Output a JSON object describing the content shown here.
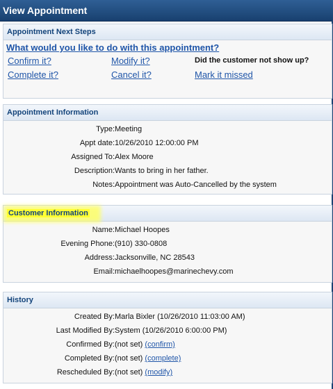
{
  "window": {
    "title": "View Appointment"
  },
  "next_steps": {
    "title": "Appointment Next Steps",
    "question": "What would you like to do with this appointment?",
    "confirm": "Confirm it?",
    "modify": "Modify it?",
    "complete": "Complete it?",
    "cancel": "Cancel it?",
    "no_show_question": "Did the customer not show up?",
    "mark_missed": "Mark it missed"
  },
  "appointment": {
    "title": "Appointment Information",
    "rows": [
      {
        "label": "Type:",
        "value": "Meeting"
      },
      {
        "label": "Appt date:",
        "value": "10/26/2010 12:00:00 PM"
      },
      {
        "label": "Assigned To:",
        "value": "Alex Moore"
      },
      {
        "label": "Description:",
        "value": "Wants to bring in her father."
      },
      {
        "label": "Notes:",
        "value": "Appointment was Auto-Cancelled by the system"
      }
    ]
  },
  "customer": {
    "title": "Customer Information",
    "rows": [
      {
        "label": "Name:",
        "value": "Michael Hoopes"
      },
      {
        "label": "Evening Phone:",
        "value": "(910) 330-0808"
      },
      {
        "label": "Address:",
        "value": "Jacksonville, NC 28543"
      },
      {
        "label": "Email:",
        "value": "michaelhoopes@marinechevy.com"
      }
    ]
  },
  "history": {
    "title": "History",
    "rows": [
      {
        "label": "Created By:",
        "value": "Marla Bixler (10/26/2010 11:03:00 AM)"
      },
      {
        "label": "Last Modified By:",
        "value": "System (10/26/2010 6:00:00 PM)"
      },
      {
        "label": "Confirmed By:",
        "value": "(not set)",
        "link": "(confirm)"
      },
      {
        "label": "Completed By:",
        "value": "(not set)",
        "link": "(complete)"
      },
      {
        "label": "Rescheduled By:",
        "value": "(not set)",
        "link": "(modify)"
      }
    ]
  }
}
